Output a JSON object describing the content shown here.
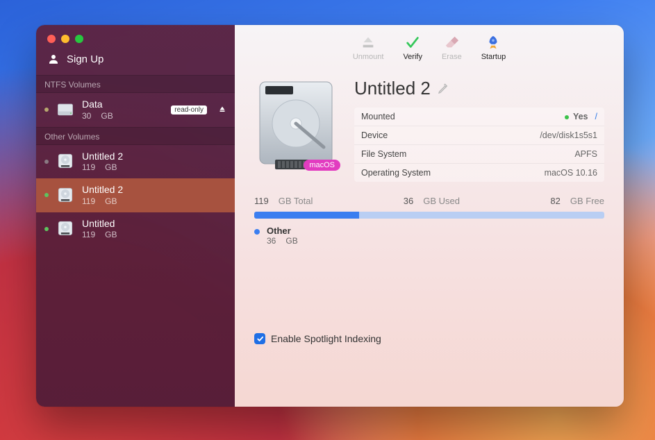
{
  "sidebar": {
    "signup_label": "Sign Up",
    "sections": [
      {
        "label": "NTFS Volumes",
        "items": [
          {
            "name": "Data",
            "size_num": "30",
            "size_unit": "GB",
            "dot": "yellow",
            "readonly_label": "read-only",
            "eject": true,
            "icon": "ext"
          }
        ]
      },
      {
        "label": "Other Volumes",
        "items": [
          {
            "name": "Untitled 2",
            "size_num": "119",
            "size_unit": "GB",
            "dot": "dim",
            "icon": "int"
          },
          {
            "name": "Untitled 2",
            "size_num": "119",
            "size_unit": "GB",
            "dot": "green",
            "icon": "int",
            "selected": true
          },
          {
            "name": "Untitled",
            "size_num": "119",
            "size_unit": "GB",
            "dot": "green",
            "icon": "int"
          }
        ]
      }
    ]
  },
  "toolbar": {
    "unmount": "Unmount",
    "verify": "Verify",
    "erase": "Erase",
    "startup": "Startup"
  },
  "volume": {
    "title": "Untitled 2",
    "os_tag": "macOS",
    "props": {
      "mounted_k": "Mounted",
      "mounted_v": "Yes",
      "mounted_path": "/",
      "device_k": "Device",
      "device_v": "/dev/disk1s5s1",
      "fs_k": "File System",
      "fs_v": "APFS",
      "os_k": "Operating System",
      "os_v": "macOS 10.16"
    }
  },
  "usage": {
    "total_num": "119",
    "total_lbl": "GB Total",
    "used_num": "36",
    "used_lbl": "GB Used",
    "free_num": "82",
    "free_lbl": "GB Free",
    "legend_label": "Other",
    "legend_num": "36",
    "legend_unit": "GB",
    "used_pct": 30
  },
  "spotlight": {
    "label": "Enable Spotlight Indexing",
    "checked": true
  }
}
